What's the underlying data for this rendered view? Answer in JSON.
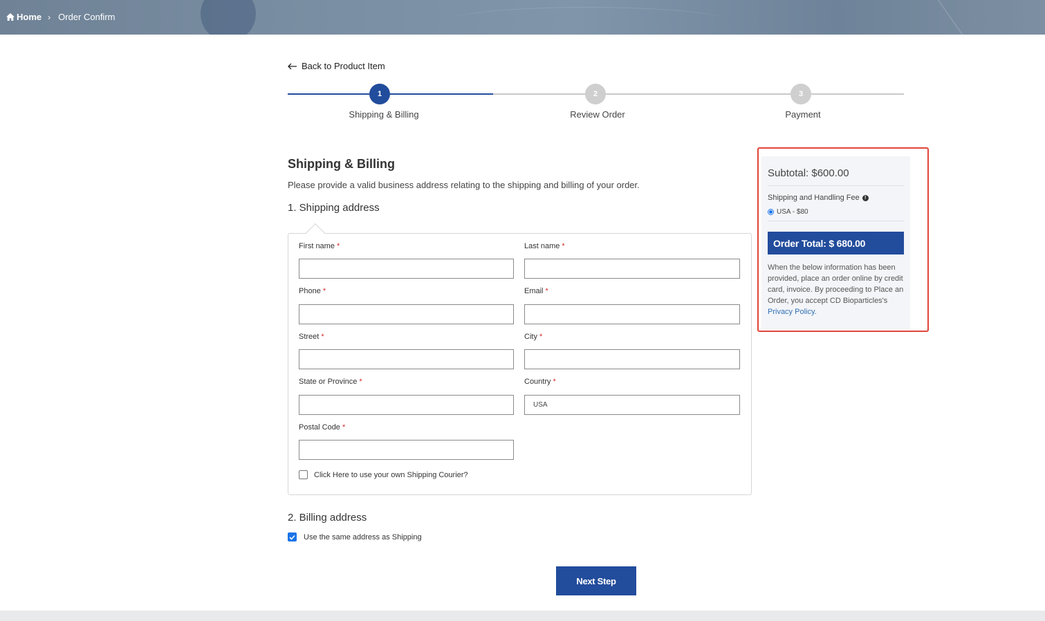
{
  "breadcrumb": {
    "home": "Home",
    "separator": "›",
    "current": "Order Confirm"
  },
  "back_link": "Back to Product Item",
  "steps": [
    {
      "number": "1",
      "label": "Shipping & Billing",
      "active": true
    },
    {
      "number": "2",
      "label": "Review Order",
      "active": false
    },
    {
      "number": "3",
      "label": "Payment",
      "active": false
    }
  ],
  "form": {
    "title": "Shipping & Billing",
    "description": "Please provide a valid business address relating to the shipping and billing of your order.",
    "shipping_heading": "1. Shipping address",
    "required_mark": "*",
    "fields": {
      "first_name": {
        "label": "First name",
        "value": ""
      },
      "last_name": {
        "label": "Last name",
        "value": ""
      },
      "phone": {
        "label": "Phone",
        "value": ""
      },
      "email": {
        "label": "Email",
        "value": ""
      },
      "street": {
        "label": "Street",
        "value": ""
      },
      "city": {
        "label": "City",
        "value": ""
      },
      "state": {
        "label": "State or Province",
        "value": ""
      },
      "country": {
        "label": "Country",
        "value": "USA"
      },
      "postal": {
        "label": "Postal Code",
        "value": ""
      }
    },
    "courier_checkbox": {
      "label": "Click Here to use your own Shipping Courier?",
      "checked": false
    },
    "billing_heading": "2. Billing address",
    "same_address_checkbox": {
      "label": "Use the same address as Shipping",
      "checked": true
    },
    "next_button": "Next Step"
  },
  "summary": {
    "subtotal": "Subtotal: $600.00",
    "shipping_fee_label": "Shipping and Handling Fee",
    "shipping_option": "USA - $80",
    "order_total": "Order Total: $ 680.00",
    "notice_text": "When the below information has been provided, place an order online by credit card, invoice. By proceeding to Place an Order, you accept CD Bioparticles's",
    "privacy_link": "Privacy Policy."
  },
  "colors": {
    "primary": "#224c9c",
    "required": "#d12b2b",
    "highlight_outline": "#e0453a",
    "link": "#2f6fb5"
  }
}
